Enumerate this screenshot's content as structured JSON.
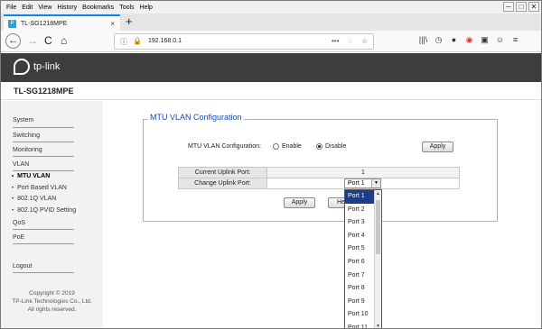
{
  "menu": {
    "items": [
      "File",
      "Edit",
      "View",
      "History",
      "Bookmarks",
      "Tools",
      "Help"
    ]
  },
  "window_controls": {
    "minimize": "─",
    "maximize": "□",
    "close": "✕"
  },
  "tab": {
    "title": "TL-SG1218MPE",
    "close": "×",
    "new_tab": "+",
    "favicon": "P"
  },
  "nav": {
    "back": "←",
    "forward": "→",
    "reload": "C",
    "home": "⌂",
    "url": "192.168.0.1",
    "info_icon": "ⓘ",
    "lock_icon": "🔒",
    "more": "•••",
    "pocket": "◌",
    "bookmark": "☆",
    "tools": [
      "|||\\",
      "◷",
      "●",
      "◉",
      "▣",
      "☺",
      "≡"
    ]
  },
  "brand": {
    "logo_text": "tp-link"
  },
  "device": {
    "model": "TL-SG1218MPE"
  },
  "sidebar": {
    "items": [
      "System",
      "Switching",
      "Monitoring",
      "VLAN"
    ],
    "subitems": [
      "MTU VLAN",
      "Port Based VLAN",
      "802.1Q VLAN",
      "802.1Q PVID Setting"
    ],
    "bullet": "•",
    "items2": [
      "QoS",
      "PoE"
    ],
    "logout": "Logout",
    "copyright": [
      "Copyright © 2019",
      "TP-Link Technologies Co., Ltd.",
      "All rights reserved."
    ]
  },
  "content": {
    "section_title": "MTU VLAN Configuration",
    "config_label": "MTU VLAN Configuration:",
    "enable_label": "Enable",
    "disable_label": "Disable",
    "selected": "Disable",
    "apply_top": "Apply",
    "table": {
      "current_label": "Current Uplink Port:",
      "current_value": "1",
      "change_label": "Change Uplink Port:",
      "change_value": "Port 1"
    },
    "apply_bottom": "Apply",
    "help_partial": "He"
  },
  "dropdown": {
    "options": [
      "Port 1",
      "Port 2",
      "Port 3",
      "Port 4",
      "Port 5",
      "Port 6",
      "Port 7",
      "Port 8",
      "Port 9",
      "Port 10",
      "Port 11"
    ],
    "selected_index": 0,
    "arrow_down": "▼",
    "arrow_up": "▲"
  }
}
